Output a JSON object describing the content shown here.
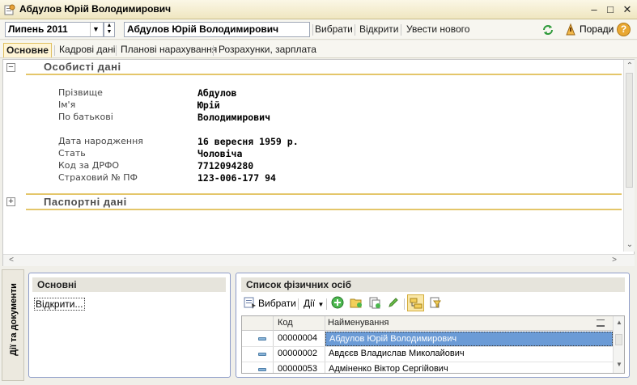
{
  "window": {
    "title": "Абдулов Юрій Володимирович",
    "icon": "app-form-icon",
    "controls": [
      "minimize-icon",
      "maximize-icon",
      "close-icon"
    ]
  },
  "toolbar": {
    "period": "Липень 2011",
    "person_name": "Абдулов Юрій Володимирович",
    "select_label": "Вибрати",
    "open_label": "Відкрити",
    "new_label": "Увести нового",
    "tips_label": "Поради",
    "help_glyph": "?"
  },
  "tabs": [
    {
      "label": "Основне",
      "active": true
    },
    {
      "label": "Кадрові дані",
      "active": false
    },
    {
      "label": "Планові нарахування",
      "active": false
    },
    {
      "label": "Розрахунки, зарплата",
      "active": false
    }
  ],
  "personal": {
    "title": "Особисті дані",
    "fields": [
      {
        "label": "Прізвище",
        "value": "Абдулов"
      },
      {
        "label": "Ім'я",
        "value": "Юрій"
      },
      {
        "label": "По батькові",
        "value": "Володимирович"
      },
      {
        "label": "Дата народження",
        "value": "16 вересня 1959 р."
      },
      {
        "label": "Стать",
        "value": "Чоловіча"
      },
      {
        "label": "Код за ДРФО",
        "value": "7712094280"
      },
      {
        "label": "Страховий № ПФ",
        "value": "123-006-177 94"
      }
    ]
  },
  "passport": {
    "title": "Паспортні дані"
  },
  "side_tab": {
    "label": "Дії та документи"
  },
  "main_panel": {
    "title": "Основні",
    "open_link": "Відкрити..."
  },
  "persons_panel": {
    "title": "Список фізичних осіб",
    "select_label": "Вибрати",
    "actions_label": "Дії",
    "columns": [
      "Код",
      "Найменування"
    ],
    "rows": [
      {
        "code": "00000004",
        "name": "Абдулов Юрій Володимирович",
        "selected": true
      },
      {
        "code": "00000002",
        "name": "Авдєєв Владислав Миколайович",
        "selected": false
      },
      {
        "code": "00000053",
        "name": "Адміненко Віктор Сергійович",
        "selected": false
      }
    ]
  }
}
